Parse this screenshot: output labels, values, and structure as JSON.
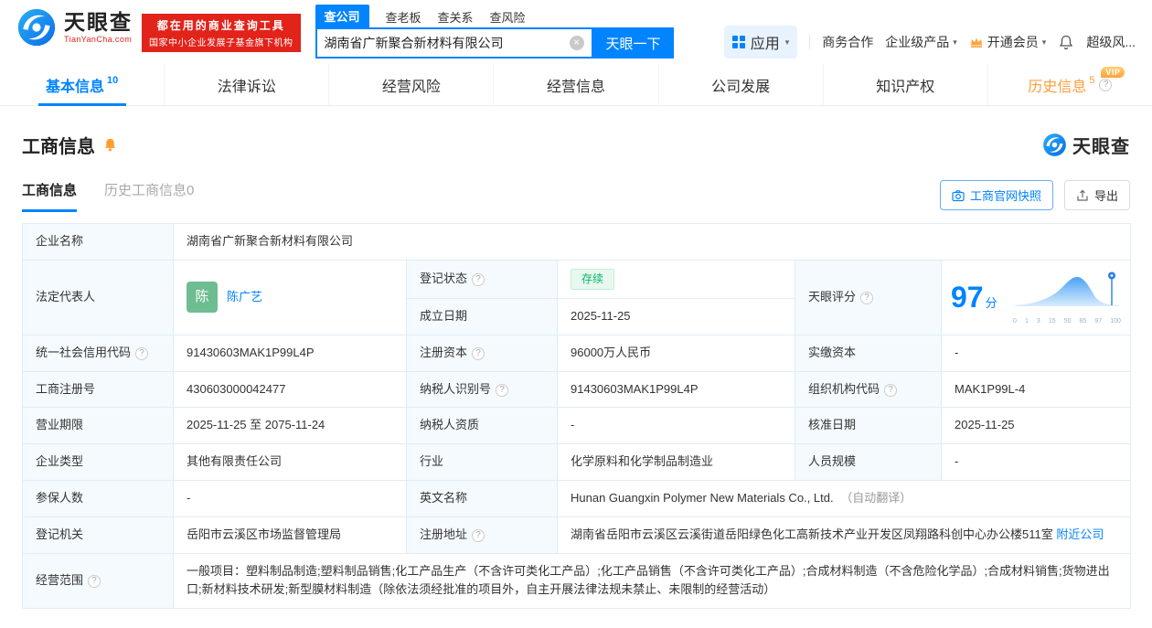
{
  "icons": {
    "help": "?",
    "caret_down": "▾",
    "clear": "×",
    "vip_badge": "VIP"
  },
  "header": {
    "logo": {
      "brand": "天眼查",
      "domain": "TianYanCha.com"
    },
    "badge": {
      "line1": "都在用的商业查询工具",
      "line2": "国家中小企业发展子基金旗下机构"
    },
    "search": {
      "tabs": [
        {
          "label": "查公司"
        },
        {
          "label": "查老板"
        },
        {
          "label": "查关系"
        },
        {
          "label": "查风险"
        }
      ],
      "value": "湖南省广新聚合新材料有限公司",
      "button": "天眼一下"
    },
    "menu": {
      "apps": "应用",
      "cooperation": "商务合作",
      "enterprise": "企业级产品",
      "vip": "开通会员",
      "more": "超级风..."
    }
  },
  "nav": {
    "tabs": [
      {
        "label": "基本信息",
        "count": "10"
      },
      {
        "label": "法律诉讼",
        "count": ""
      },
      {
        "label": "经营风险",
        "count": ""
      },
      {
        "label": "经营信息",
        "count": ""
      },
      {
        "label": "公司发展",
        "count": ""
      },
      {
        "label": "知识产权",
        "count": ""
      },
      {
        "label": "历史信息",
        "count": "5"
      }
    ]
  },
  "section": {
    "title": "工商信息",
    "brand": "天眼查",
    "tabs": {
      "current": "工商信息",
      "history": "历史工商信息0"
    },
    "snapshot_button": "工商官网快照",
    "export_button": "导出"
  },
  "score_chart": {
    "score": "97",
    "unit": "分",
    "ticks": [
      "0",
      "1",
      "3",
      "15",
      "50",
      "85",
      "97",
      "100"
    ]
  },
  "info": {
    "company_name": {
      "label": "企业名称",
      "value": "湖南省广新聚合新材料有限公司"
    },
    "legal_rep": {
      "label": "法定代表人",
      "avatar": "陈",
      "value": "陈广艺"
    },
    "reg_status": {
      "label": "登记状态",
      "value": "存续"
    },
    "establish_date": {
      "label": "成立日期",
      "value": "2025-11-25"
    },
    "tyc_score": {
      "label": "天眼评分"
    },
    "credit_code": {
      "label": "统一社会信用代码",
      "value": "91430603MAK1P99L4P"
    },
    "reg_capital": {
      "label": "注册资本",
      "value": "96000万人民币"
    },
    "paid_capital": {
      "label": "实缴资本",
      "value": "-"
    },
    "reg_number": {
      "label": "工商注册号",
      "value": "430603000042477"
    },
    "taxpayer_id": {
      "label": "纳税人识别号",
      "value": "91430603MAK1P99L4P"
    },
    "org_code": {
      "label": "组织机构代码",
      "value": "MAK1P99L-4"
    },
    "business_term": {
      "label": "营业期限",
      "value": "2025-11-25 至 2075-11-24"
    },
    "taxpayer_qualification": {
      "label": "纳税人资质",
      "value": "-"
    },
    "approval_date": {
      "label": "核准日期",
      "value": "2025-11-25"
    },
    "company_type": {
      "label": "企业类型",
      "value": "其他有限责任公司"
    },
    "industry": {
      "label": "行业",
      "value": "化学原料和化学制品制造业"
    },
    "staff_size": {
      "label": "人员规模",
      "value": "-"
    },
    "insured_count": {
      "label": "参保人数",
      "value": "-"
    },
    "english_name": {
      "label": "英文名称",
      "value": "Hunan Guangxin Polymer New Materials Co., Ltd.",
      "note": "（自动翻译）"
    },
    "reg_authority": {
      "label": "登记机关",
      "value": "岳阳市云溪区市场监督管理局"
    },
    "reg_address": {
      "label": "注册地址",
      "value": "湖南省岳阳市云溪区云溪街道岳阳绿色化工高新技术产业开发区凤翔路科创中心办公楼511室",
      "link": "附近公司"
    },
    "business_scope": {
      "label": "经营范围",
      "value": "一般项目：塑料制品制造;塑料制品销售;化工产品生产（不含许可类化工产品）;化工产品销售（不含许可类化工产品）;合成材料制造（不含危险化学品）;合成材料销售;货物进出口;新材料技术研发;新型膜材料制造（除依法须经批准的项目外，自主开展法律法规未禁止、未限制的经营活动）"
    }
  }
}
